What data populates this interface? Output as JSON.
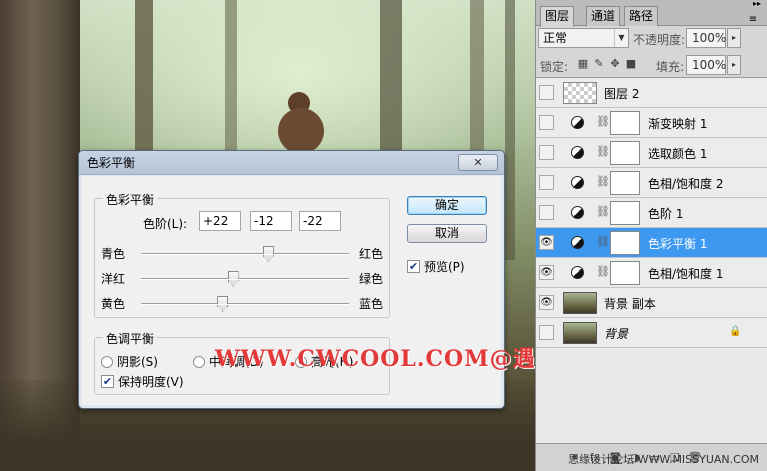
{
  "dialog": {
    "title": "色彩平衡",
    "close_glyph": "✕",
    "color_balance": {
      "legend": "色彩平衡",
      "levels_label": "色阶(L):",
      "levels": [
        "+22",
        "-12",
        "-22"
      ],
      "sliders": [
        {
          "left": "青色",
          "right": "红色",
          "value": 22
        },
        {
          "left": "洋红",
          "right": "绿色",
          "value": -12
        },
        {
          "left": "黄色",
          "right": "蓝色",
          "value": -22
        }
      ]
    },
    "tone_balance": {
      "legend": "色调平衡",
      "options": [
        "阴影(S)",
        "中间调(D)",
        "高光(H)"
      ],
      "selected": "高光(H)",
      "preserve_luminosity": "保持明度(V)",
      "preserve_checked": true
    },
    "ok_label": "确定",
    "cancel_label": "取消",
    "preview_label": "预览(P)",
    "preview_checked": true
  },
  "watermark": "WWW.CWCOOL.COM@遇",
  "panel": {
    "tabs": [
      "图层",
      "通道",
      "路径"
    ],
    "active_tab": "图层",
    "blend_mode": "正常",
    "opacity_label": "不透明度:",
    "opacity": "100%",
    "lock_label": "锁定:",
    "fill_label": "填充:",
    "fill": "100%",
    "layers": [
      {
        "name": "图层 2",
        "kind": "transparent",
        "visible": false,
        "selected": false
      },
      {
        "name": "渐变映射 1",
        "kind": "adjustment",
        "visible": false,
        "selected": false
      },
      {
        "name": "选取颜色 1",
        "kind": "adjustment",
        "visible": false,
        "selected": false
      },
      {
        "name": "色相/饱和度 2",
        "kind": "adjustment",
        "visible": false,
        "selected": false
      },
      {
        "name": "色阶 1",
        "kind": "adjustment",
        "visible": false,
        "selected": false
      },
      {
        "name": "色彩平衡 1",
        "kind": "adjustment",
        "visible": true,
        "selected": true
      },
      {
        "name": "色相/饱和度 1",
        "kind": "adjustment",
        "visible": true,
        "selected": false
      },
      {
        "name": "背景 副本",
        "kind": "photo",
        "visible": true,
        "selected": false
      },
      {
        "name": "背景",
        "kind": "photo",
        "visible": false,
        "selected": false,
        "locked": true
      }
    ],
    "site_mark": "思缘设计论坛 WWW.MISSYUAN.COM"
  },
  "colors": {
    "selection": "#3d98f0",
    "watermark": "#e23a3a"
  }
}
